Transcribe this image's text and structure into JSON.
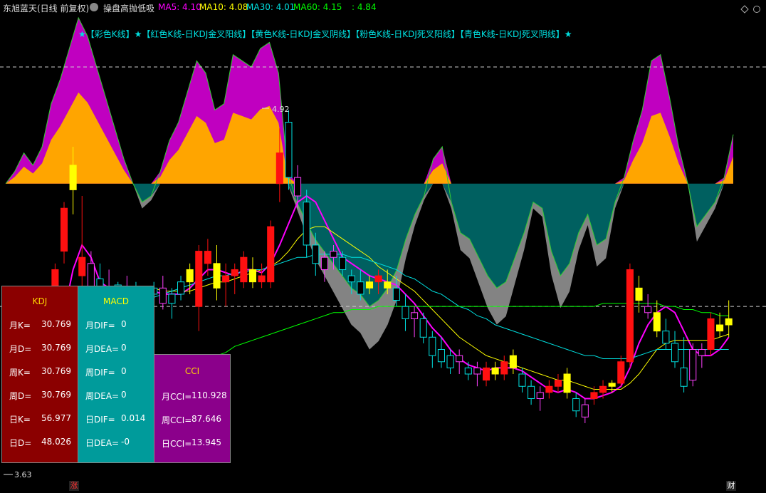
{
  "header": {
    "stock_name": "东旭蓝天(日线 前复权)",
    "indicator_name": "操盘高抛低吸",
    "ma5": "MA5: 4.10",
    "ma10": "MA10: 4.08",
    "ma30": "MA30: 4.01",
    "ma60": "MA60: 4.15",
    "extra": ": 4.84",
    "colors": {
      "ma5": "#ff00ff",
      "ma10": "#ffff00",
      "ma30": "#00e0e0",
      "ma60": "#00ff00"
    }
  },
  "legend_text": "★【彩色K线】★【红色K线-日KDJ金叉阳线】【黄色K线-日KDJ金叉阴线】【粉色K线-日KDJ死叉阳线】【青色K线-日KDJ死叉阴线】★",
  "annotations": {
    "high": "4.92",
    "low": "3.63"
  },
  "badges": {
    "left": "涨",
    "right": "财"
  },
  "panels": {
    "kdj": {
      "title": "KDJ",
      "bg": "#8b0000",
      "rows": [
        {
          "label": "月K=",
          "value": "30.769"
        },
        {
          "label": "月D=",
          "value": "30.769"
        },
        {
          "label": "周K=",
          "value": "30.769"
        },
        {
          "label": "周D=",
          "value": "30.769"
        },
        {
          "label": "日K=",
          "value": "56.977"
        },
        {
          "label": "日D=",
          "value": "48.026"
        }
      ]
    },
    "macd": {
      "title": "MACD",
      "bg": "#009b9b",
      "rows": [
        {
          "label": "月DIF=",
          "value": "0"
        },
        {
          "label": "月DEA=",
          "value": "0"
        },
        {
          "label": "周DIF=",
          "value": "0"
        },
        {
          "label": "周DEA=",
          "value": "0"
        },
        {
          "label": "日DIF=",
          "value": "0.014"
        },
        {
          "label": "日DEA=",
          "value": "-0"
        }
      ]
    },
    "cci": {
      "title": "CCI",
      "bg": "#8b008b",
      "rows": [
        {
          "label": "月CCI=",
          "value": "110.928"
        },
        {
          "label": "周CCI=",
          "value": "87.646"
        },
        {
          "label": "日CCI=",
          "value": "13.945"
        }
      ]
    }
  },
  "chart_data": {
    "type": "candlestick",
    "ylim": [
      3.55,
      5.0
    ],
    "reference_lines": [
      4.84,
      4.06
    ],
    "candles": [
      {
        "o": 3.7,
        "h": 3.72,
        "l": 3.62,
        "c": 3.65,
        "t": "c"
      },
      {
        "o": 3.66,
        "h": 3.7,
        "l": 3.63,
        "c": 3.68,
        "t": "y"
      },
      {
        "o": 3.67,
        "h": 3.69,
        "l": 3.64,
        "c": 3.66,
        "t": "r"
      },
      {
        "o": 3.66,
        "h": 3.92,
        "l": 3.65,
        "c": 3.9,
        "t": "r"
      },
      {
        "o": 3.9,
        "h": 4.12,
        "l": 3.88,
        "c": 4.1,
        "t": "r"
      },
      {
        "o": 4.1,
        "h": 4.2,
        "l": 4.05,
        "c": 4.18,
        "t": "r"
      },
      {
        "o": 4.38,
        "h": 4.4,
        "l": 4.2,
        "c": 4.24,
        "t": "r"
      },
      {
        "o": 4.52,
        "h": 4.58,
        "l": 4.36,
        "c": 4.44,
        "t": "y"
      },
      {
        "o": 4.22,
        "h": 4.42,
        "l": 4.1,
        "c": 4.16,
        "t": "r"
      },
      {
        "o": 4.2,
        "h": 4.24,
        "l": 4.05,
        "c": 4.1,
        "t": "p"
      },
      {
        "o": 4.1,
        "h": 4.2,
        "l": 4.04,
        "c": 4.15,
        "t": "c"
      },
      {
        "o": 4.12,
        "h": 4.18,
        "l": 4.06,
        "c": 4.08,
        "t": "p"
      },
      {
        "o": 4.09,
        "h": 4.14,
        "l": 4.05,
        "c": 4.13,
        "t": "c"
      },
      {
        "o": 4.12,
        "h": 4.16,
        "l": 4.06,
        "c": 4.1,
        "t": "p"
      },
      {
        "o": 4.1,
        "h": 4.14,
        "l": 4.06,
        "c": 4.08,
        "t": "c"
      },
      {
        "o": 4.08,
        "h": 4.12,
        "l": 4.04,
        "c": 4.1,
        "t": "p"
      },
      {
        "o": 4.1,
        "h": 4.14,
        "l": 4.06,
        "c": 4.12,
        "t": "c"
      },
      {
        "o": 4.12,
        "h": 4.16,
        "l": 4.05,
        "c": 4.07,
        "t": "p"
      },
      {
        "o": 4.07,
        "h": 4.12,
        "l": 4.02,
        "c": 4.1,
        "t": "c"
      },
      {
        "o": 4.1,
        "h": 4.16,
        "l": 4.08,
        "c": 4.14,
        "t": "c"
      },
      {
        "o": 4.14,
        "h": 4.2,
        "l": 4.1,
        "c": 4.18,
        "t": "y"
      },
      {
        "o": 4.06,
        "h": 4.26,
        "l": 3.98,
        "c": 4.24,
        "t": "r"
      },
      {
        "o": 4.24,
        "h": 4.28,
        "l": 4.16,
        "c": 4.2,
        "t": "r"
      },
      {
        "o": 4.2,
        "h": 4.26,
        "l": 4.08,
        "c": 4.12,
        "t": "y"
      },
      {
        "o": 4.14,
        "h": 4.2,
        "l": 4.06,
        "c": 4.16,
        "t": "r"
      },
      {
        "o": 4.16,
        "h": 4.2,
        "l": 4.1,
        "c": 4.18,
        "t": "r"
      },
      {
        "o": 4.14,
        "h": 4.24,
        "l": 4.12,
        "c": 4.22,
        "t": "r"
      },
      {
        "o": 4.18,
        "h": 4.22,
        "l": 4.12,
        "c": 4.14,
        "t": "y"
      },
      {
        "o": 4.16,
        "h": 4.2,
        "l": 4.12,
        "c": 4.14,
        "t": "r"
      },
      {
        "o": 4.14,
        "h": 4.34,
        "l": 4.12,
        "c": 4.32,
        "t": "r"
      },
      {
        "o": 4.56,
        "h": 4.64,
        "l": 4.4,
        "c": 4.46,
        "t": "r"
      },
      {
        "o": 4.66,
        "h": 4.7,
        "l": 4.44,
        "c": 4.48,
        "t": "c"
      },
      {
        "o": 4.48,
        "h": 4.52,
        "l": 4.38,
        "c": 4.42,
        "t": "p"
      },
      {
        "o": 4.4,
        "h": 4.44,
        "l": 4.22,
        "c": 4.26,
        "t": "c"
      },
      {
        "o": 4.26,
        "h": 4.3,
        "l": 4.16,
        "c": 4.2,
        "t": "c"
      },
      {
        "o": 4.18,
        "h": 4.24,
        "l": 4.14,
        "c": 4.22,
        "t": "p"
      },
      {
        "o": 4.22,
        "h": 4.26,
        "l": 4.18,
        "c": 4.24,
        "t": "p"
      },
      {
        "o": 4.22,
        "h": 4.24,
        "l": 4.16,
        "c": 4.18,
        "t": "c"
      },
      {
        "o": 4.16,
        "h": 4.18,
        "l": 4.1,
        "c": 4.14,
        "t": "c"
      },
      {
        "o": 4.14,
        "h": 4.18,
        "l": 4.08,
        "c": 4.1,
        "t": "c"
      },
      {
        "o": 4.12,
        "h": 4.16,
        "l": 4.1,
        "c": 4.14,
        "t": "y"
      },
      {
        "o": 4.14,
        "h": 4.18,
        "l": 4.1,
        "c": 4.16,
        "t": "r"
      },
      {
        "o": 4.14,
        "h": 4.18,
        "l": 4.1,
        "c": 4.12,
        "t": "y"
      },
      {
        "o": 4.12,
        "h": 4.16,
        "l": 4.06,
        "c": 4.08,
        "t": "c"
      },
      {
        "o": 4.06,
        "h": 4.1,
        "l": 3.98,
        "c": 4.02,
        "t": "c"
      },
      {
        "o": 4.02,
        "h": 4.06,
        "l": 3.96,
        "c": 4.04,
        "t": "p"
      },
      {
        "o": 4.02,
        "h": 4.04,
        "l": 3.94,
        "c": 3.96,
        "t": "c"
      },
      {
        "o": 3.96,
        "h": 3.98,
        "l": 3.86,
        "c": 3.9,
        "t": "c"
      },
      {
        "o": 3.92,
        "h": 3.96,
        "l": 3.86,
        "c": 3.88,
        "t": "c"
      },
      {
        "o": 3.9,
        "h": 3.92,
        "l": 3.84,
        "c": 3.86,
        "t": "c"
      },
      {
        "o": 3.88,
        "h": 3.92,
        "l": 3.84,
        "c": 3.9,
        "t": "p"
      },
      {
        "o": 3.86,
        "h": 3.88,
        "l": 3.82,
        "c": 3.84,
        "t": "c"
      },
      {
        "o": 3.84,
        "h": 3.88,
        "l": 3.8,
        "c": 3.86,
        "t": "p"
      },
      {
        "o": 3.82,
        "h": 3.88,
        "l": 3.8,
        "c": 3.86,
        "t": "r"
      },
      {
        "o": 3.84,
        "h": 3.88,
        "l": 3.82,
        "c": 3.86,
        "t": "y"
      },
      {
        "o": 3.84,
        "h": 3.9,
        "l": 3.82,
        "c": 3.88,
        "t": "r"
      },
      {
        "o": 3.9,
        "h": 3.92,
        "l": 3.84,
        "c": 3.86,
        "t": "y"
      },
      {
        "o": 3.84,
        "h": 3.86,
        "l": 3.78,
        "c": 3.8,
        "t": "c"
      },
      {
        "o": 3.8,
        "h": 3.82,
        "l": 3.74,
        "c": 3.76,
        "t": "c"
      },
      {
        "o": 3.76,
        "h": 3.8,
        "l": 3.72,
        "c": 3.78,
        "t": "p"
      },
      {
        "o": 3.78,
        "h": 3.82,
        "l": 3.76,
        "c": 3.8,
        "t": "r"
      },
      {
        "o": 3.8,
        "h": 3.84,
        "l": 3.78,
        "c": 3.82,
        "t": "r"
      },
      {
        "o": 3.84,
        "h": 3.86,
        "l": 3.76,
        "c": 3.78,
        "t": "y"
      },
      {
        "o": 3.76,
        "h": 3.78,
        "l": 3.7,
        "c": 3.72,
        "t": "c"
      },
      {
        "o": 3.7,
        "h": 3.76,
        "l": 3.68,
        "c": 3.74,
        "t": "p"
      },
      {
        "o": 3.76,
        "h": 3.8,
        "l": 3.74,
        "c": 3.78,
        "t": "r"
      },
      {
        "o": 3.78,
        "h": 3.82,
        "l": 3.76,
        "c": 3.8,
        "t": "r"
      },
      {
        "o": 3.8,
        "h": 3.82,
        "l": 3.78,
        "c": 3.81,
        "t": "y"
      },
      {
        "o": 3.81,
        "h": 3.9,
        "l": 3.8,
        "c": 3.88,
        "t": "r"
      },
      {
        "o": 3.88,
        "h": 4.2,
        "l": 3.86,
        "c": 4.18,
        "t": "r"
      },
      {
        "o": 4.12,
        "h": 4.16,
        "l": 4.04,
        "c": 4.08,
        "t": "y"
      },
      {
        "o": 4.06,
        "h": 4.1,
        "l": 4.02,
        "c": 4.04,
        "t": "p"
      },
      {
        "o": 4.04,
        "h": 4.08,
        "l": 3.96,
        "c": 3.98,
        "t": "y"
      },
      {
        "o": 3.98,
        "h": 4.02,
        "l": 3.92,
        "c": 3.94,
        "t": "c"
      },
      {
        "o": 3.94,
        "h": 3.98,
        "l": 3.86,
        "c": 3.88,
        "t": "c"
      },
      {
        "o": 3.86,
        "h": 3.96,
        "l": 3.78,
        "c": 3.8,
        "t": "c"
      },
      {
        "o": 3.82,
        "h": 3.94,
        "l": 3.8,
        "c": 3.92,
        "t": "p"
      },
      {
        "o": 3.9,
        "h": 3.94,
        "l": 3.86,
        "c": 3.92,
        "t": "p"
      },
      {
        "o": 3.92,
        "h": 4.04,
        "l": 3.9,
        "c": 4.02,
        "t": "r"
      },
      {
        "o": 4.0,
        "h": 4.04,
        "l": 3.96,
        "c": 3.98,
        "t": "y"
      },
      {
        "o": 4.02,
        "h": 4.08,
        "l": 3.96,
        "c": 4.0,
        "t": "y"
      }
    ],
    "ma_lines": [
      {
        "name": "MA5",
        "color": "#ff00ff",
        "values": [
          3.7,
          3.68,
          3.67,
          3.72,
          3.82,
          3.92,
          4.04,
          4.18,
          4.26,
          4.22,
          4.14,
          4.12,
          4.11,
          4.11,
          4.1,
          4.1,
          4.11,
          4.1,
          4.1,
          4.1,
          4.12,
          4.15,
          4.18,
          4.18,
          4.17,
          4.16,
          4.18,
          4.18,
          4.17,
          4.2,
          4.26,
          4.33,
          4.4,
          4.42,
          4.4,
          4.34,
          4.28,
          4.22,
          4.2,
          4.18,
          4.16,
          4.15,
          4.14,
          4.13,
          4.1,
          4.07,
          4.03,
          3.99,
          3.96,
          3.92,
          3.89,
          3.87,
          3.86,
          3.85,
          3.86,
          3.86,
          3.86,
          3.85,
          3.83,
          3.81,
          3.79,
          3.78,
          3.79,
          3.78,
          3.76,
          3.76,
          3.77,
          3.78,
          3.8,
          3.86,
          3.94,
          4.0,
          4.04,
          4.06,
          4.04,
          3.98,
          3.92,
          3.9,
          3.9,
          3.92,
          3.96
        ]
      },
      {
        "name": "MA10",
        "color": "#ffff00",
        "values": [
          3.78,
          3.76,
          3.74,
          3.74,
          3.76,
          3.8,
          3.86,
          3.93,
          3.99,
          4.04,
          4.08,
          4.1,
          4.11,
          4.12,
          4.12,
          4.12,
          4.12,
          4.11,
          4.11,
          4.11,
          4.11,
          4.12,
          4.13,
          4.14,
          4.14,
          4.15,
          4.16,
          4.17,
          4.18,
          4.19,
          4.21,
          4.24,
          4.28,
          4.31,
          4.32,
          4.32,
          4.3,
          4.28,
          4.26,
          4.24,
          4.22,
          4.19,
          4.17,
          4.15,
          4.13,
          4.11,
          4.08,
          4.05,
          4.02,
          3.99,
          3.96,
          3.94,
          3.92,
          3.9,
          3.89,
          3.88,
          3.87,
          3.86,
          3.85,
          3.84,
          3.83,
          3.82,
          3.82,
          3.81,
          3.8,
          3.79,
          3.79,
          3.79,
          3.79,
          3.81,
          3.84,
          3.88,
          3.92,
          3.94,
          3.95,
          3.95,
          3.95,
          3.95,
          3.95,
          3.96,
          3.97
        ]
      },
      {
        "name": "MA30",
        "color": "#00e0e0",
        "values": [
          3.92,
          3.92,
          3.91,
          3.91,
          3.91,
          3.92,
          3.93,
          3.95,
          3.97,
          3.99,
          4.01,
          4.03,
          4.05,
          4.06,
          4.07,
          4.08,
          4.09,
          4.1,
          4.11,
          4.12,
          4.13,
          4.14,
          4.15,
          4.16,
          4.16,
          4.17,
          4.17,
          4.18,
          4.18,
          4.19,
          4.2,
          4.21,
          4.22,
          4.22,
          4.23,
          4.23,
          4.23,
          4.23,
          4.22,
          4.22,
          4.21,
          4.2,
          4.19,
          4.18,
          4.16,
          4.15,
          4.13,
          4.11,
          4.1,
          4.08,
          4.06,
          4.05,
          4.03,
          4.02,
          4.0,
          3.99,
          3.98,
          3.97,
          3.96,
          3.95,
          3.94,
          3.93,
          3.92,
          3.91,
          3.9,
          3.9,
          3.89,
          3.89,
          3.89,
          3.89,
          3.9,
          3.91,
          3.92,
          3.92,
          3.92,
          3.92,
          3.92,
          3.92,
          3.92,
          3.92,
          3.92
        ]
      },
      {
        "name": "MA60",
        "color": "#00ff00",
        "values": [
          3.6,
          3.61,
          3.62,
          3.63,
          3.64,
          3.65,
          3.66,
          3.67,
          3.68,
          3.7,
          3.71,
          3.73,
          3.74,
          3.76,
          3.77,
          3.79,
          3.8,
          3.82,
          3.83,
          3.85,
          3.86,
          3.87,
          3.89,
          3.9,
          3.91,
          3.93,
          3.94,
          3.95,
          3.96,
          3.97,
          3.98,
          3.99,
          4.0,
          4.01,
          4.02,
          4.03,
          4.04,
          4.04,
          4.05,
          4.05,
          4.05,
          4.06,
          4.06,
          4.06,
          4.06,
          4.06,
          4.06,
          4.06,
          4.06,
          4.06,
          4.06,
          4.06,
          4.06,
          4.06,
          4.06,
          4.06,
          4.06,
          4.06,
          4.06,
          4.06,
          4.06,
          4.06,
          4.06,
          4.06,
          4.06,
          4.06,
          4.07,
          4.07,
          4.07,
          4.07,
          4.07,
          4.07,
          4.07,
          4.06,
          4.06,
          4.05,
          4.05,
          4.04,
          4.04,
          4.03,
          4.03
        ]
      }
    ],
    "indicator_band": {
      "baseline": 4.46,
      "colors": {
        "magenta": "#c000c0",
        "orange": "#ffa500",
        "teal": "#006060",
        "gray": "#8a8a8a",
        "edge": "#33cc33"
      },
      "upper": [
        4.46,
        4.5,
        4.56,
        4.52,
        4.58,
        4.72,
        4.8,
        4.9,
        5.0,
        4.94,
        4.84,
        4.74,
        4.64,
        4.54,
        4.46,
        4.4,
        4.42,
        4.5,
        4.6,
        4.66,
        4.76,
        4.86,
        4.82,
        4.7,
        4.72,
        4.88,
        4.86,
        4.84,
        4.9,
        4.92,
        4.82,
        4.5,
        4.4,
        4.34,
        4.28,
        4.24,
        4.2,
        4.16,
        4.12,
        4.1,
        4.06,
        4.08,
        4.12,
        4.18,
        4.28,
        4.36,
        4.42,
        4.54,
        4.58,
        4.4,
        4.3,
        4.28,
        4.22,
        4.16,
        4.12,
        4.14,
        4.22,
        4.3,
        4.4,
        4.38,
        4.24,
        4.16,
        4.2,
        4.3,
        4.36,
        4.26,
        4.28,
        4.4,
        4.48,
        4.6,
        4.7,
        4.86,
        4.88,
        4.74,
        4.58,
        4.46,
        4.32,
        4.36,
        4.4,
        4.48,
        4.62
      ]
    }
  }
}
